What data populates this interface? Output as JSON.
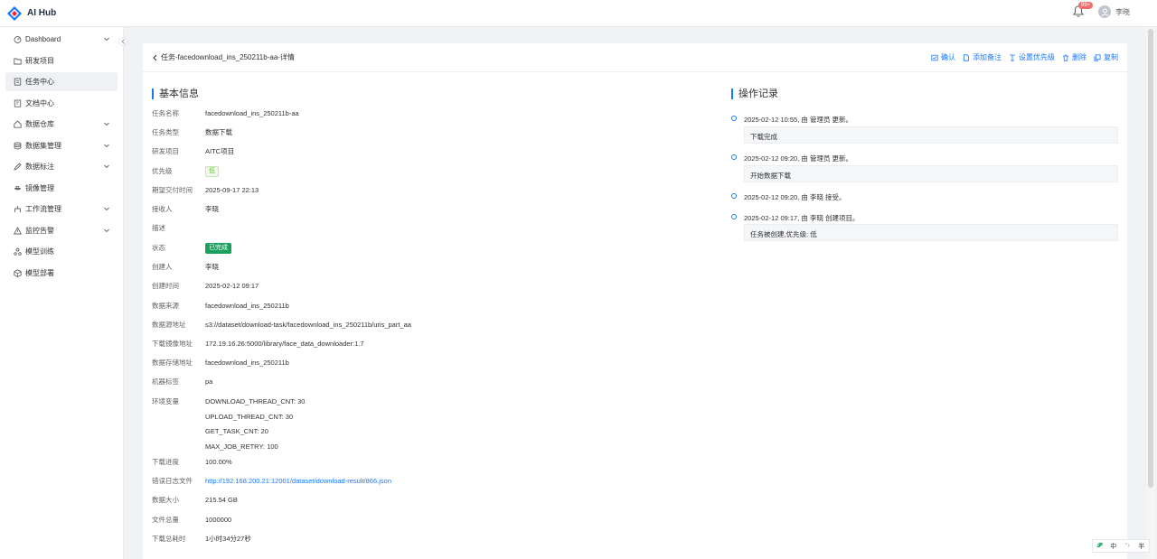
{
  "app": {
    "title": "AI Hub",
    "brand_color": "#1677ff"
  },
  "header": {
    "notification_badge": "99+",
    "username": "李晓"
  },
  "sidebar": {
    "items": [
      {
        "label": "Dashboard",
        "icon": "dashboard-icon",
        "has_arrow": true
      },
      {
        "label": "研发项目",
        "icon": "folder-icon",
        "has_arrow": false
      },
      {
        "label": "任务中心",
        "icon": "task-icon",
        "has_arrow": false,
        "active": true
      },
      {
        "label": "文档中心",
        "icon": "document-icon",
        "has_arrow": false
      },
      {
        "label": "数据仓库",
        "icon": "warehouse-icon",
        "has_arrow": true
      },
      {
        "label": "数据集管理",
        "icon": "dataset-icon",
        "has_arrow": true
      },
      {
        "label": "数据标注",
        "icon": "annotate-icon",
        "has_arrow": true
      },
      {
        "label": "镜像管理",
        "icon": "image-icon",
        "has_arrow": false
      },
      {
        "label": "工作流管理",
        "icon": "workflow-icon",
        "has_arrow": true
      },
      {
        "label": "监控告警",
        "icon": "alert-icon",
        "has_arrow": true
      },
      {
        "label": "模型训练",
        "icon": "train-icon",
        "has_arrow": false
      },
      {
        "label": "模型部署",
        "icon": "deploy-icon",
        "has_arrow": false
      }
    ]
  },
  "page": {
    "back_title": "任务-facedownload_ins_250211b-aa-详情",
    "actions": [
      {
        "label": "确认",
        "icon": "confirm-icon"
      },
      {
        "label": "添加备注",
        "icon": "note-icon"
      },
      {
        "label": "设置优先级",
        "icon": "priority-icon"
      },
      {
        "label": "删除",
        "icon": "delete-icon"
      },
      {
        "label": "复制",
        "icon": "copy-icon"
      }
    ]
  },
  "basic_info": {
    "title": "基本信息",
    "fields": [
      {
        "k": "任务名称",
        "v": "facedownload_ins_250211b-aa"
      },
      {
        "k": "任务类型",
        "v": "数据下载"
      },
      {
        "k": "研发项目",
        "v": "AITC项目"
      },
      {
        "k": "优先级",
        "v": "低"
      },
      {
        "k": "期望交付时间",
        "v": "2025-09-17 22:13"
      },
      {
        "k": "接收人",
        "v": "李晓"
      },
      {
        "k": "描述",
        "v": ""
      },
      {
        "k": "状态",
        "v": "已完成"
      },
      {
        "k": "创建人",
        "v": "李晓"
      },
      {
        "k": "创建时间",
        "v": "2025-02-12 09:17"
      },
      {
        "k": "数据来源",
        "v": "facedownload_ins_250211b"
      },
      {
        "k": "数据源地址",
        "v": "s3://dataset/download-task/facedownload_ins_250211b/uris_part_aa"
      },
      {
        "k": "下载镜像地址",
        "v": "172.19.16.26:5000/library/face_data_downloader:1.7"
      },
      {
        "k": "数据存储地址",
        "v": "facedownload_ins_250211b"
      },
      {
        "k": "机器标签",
        "v": "pa"
      },
      {
        "k": "环境变量",
        "v": "DOWNLOAD_THREAD_CNT: 30"
      },
      {
        "k": "",
        "v": "UPLOAD_THREAD_CNT: 30"
      },
      {
        "k": "",
        "v": "GET_TASK_CNT: 20"
      },
      {
        "k": "",
        "v": "MAX_JOB_RETRY: 100"
      },
      {
        "k": "下载进度",
        "v": "100.00%"
      },
      {
        "k": "错误日志文件",
        "v": "http://192.168.200.21:12001/dataset/download-result/866.json"
      },
      {
        "k": "数据大小",
        "v": "215.54 GB"
      },
      {
        "k": "文件总量",
        "v": "1000000"
      },
      {
        "k": "下载总耗时",
        "v": "1小时34分27秒"
      }
    ]
  },
  "operation_log": {
    "title": "操作记录",
    "entries": [
      {
        "text": "2025-02-12 10:55, 由 管理员 更新。",
        "note": "下载完成"
      },
      {
        "text": "2025-02-12 09:20, 由 管理员 更新。",
        "note": "开始数据下载"
      },
      {
        "text": "2025-02-12 09:20, 由 李晓 接受。",
        "note": ""
      },
      {
        "text": "2025-02-12 09:17, 由 李晓 创建项目。",
        "note": "任务被创建,优先级: 低"
      }
    ]
  },
  "ime": {
    "lang": "中",
    "mode": "半"
  }
}
